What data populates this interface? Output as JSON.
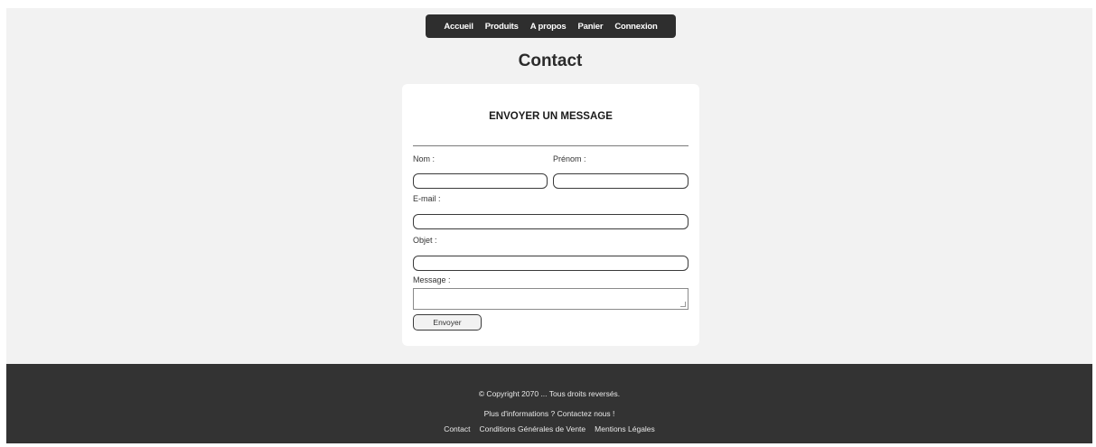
{
  "nav": {
    "items": [
      "Accueil",
      "Produits",
      "A propos",
      "Panier",
      "Connexion"
    ]
  },
  "page": {
    "title": "Contact"
  },
  "form": {
    "heading": "ENVOYER UN MESSAGE",
    "nom_label": "Nom :",
    "prenom_label": "Prénom :",
    "email_label": "E-mail :",
    "objet_label": "Objet :",
    "message_label": "Message :",
    "submit_label": "Envoyer"
  },
  "footer": {
    "copyright": "© Copyright 2070 ... Tous droits reversés.",
    "info": "Plus d'informations ? Contactez nous !",
    "links": [
      "Contact",
      "Conditions Générales de Vente",
      "Mentions Légales"
    ]
  },
  "colors": {
    "page_bg": "#f2f2f2",
    "nav_bg": "#2e2e2e",
    "footer_bg": "#333333",
    "card_bg": "#ffffff"
  }
}
